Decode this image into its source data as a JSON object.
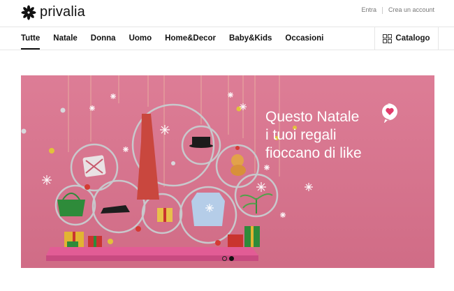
{
  "header": {
    "logo_text": "privalia",
    "login_label": "Entra",
    "signup_label": "Crea un account"
  },
  "nav": {
    "items": [
      {
        "label": "Tutte",
        "active": true
      },
      {
        "label": "Natale"
      },
      {
        "label": "Donna"
      },
      {
        "label": "Uomo"
      },
      {
        "label": "Home&Decor"
      },
      {
        "label": "Baby&Kids"
      },
      {
        "label": "Occasioni"
      }
    ],
    "catalog_label": "Catalogo"
  },
  "banner": {
    "headline_line1": "Questo Natale",
    "headline_line2": "i tuoi regali",
    "headline_line3": "fioccano di like",
    "background_color": "#d9758f",
    "slides": 2,
    "active_slide": 2
  },
  "colors": {
    "text": "#111111",
    "muted": "#777777",
    "border": "#e6e6e6"
  }
}
